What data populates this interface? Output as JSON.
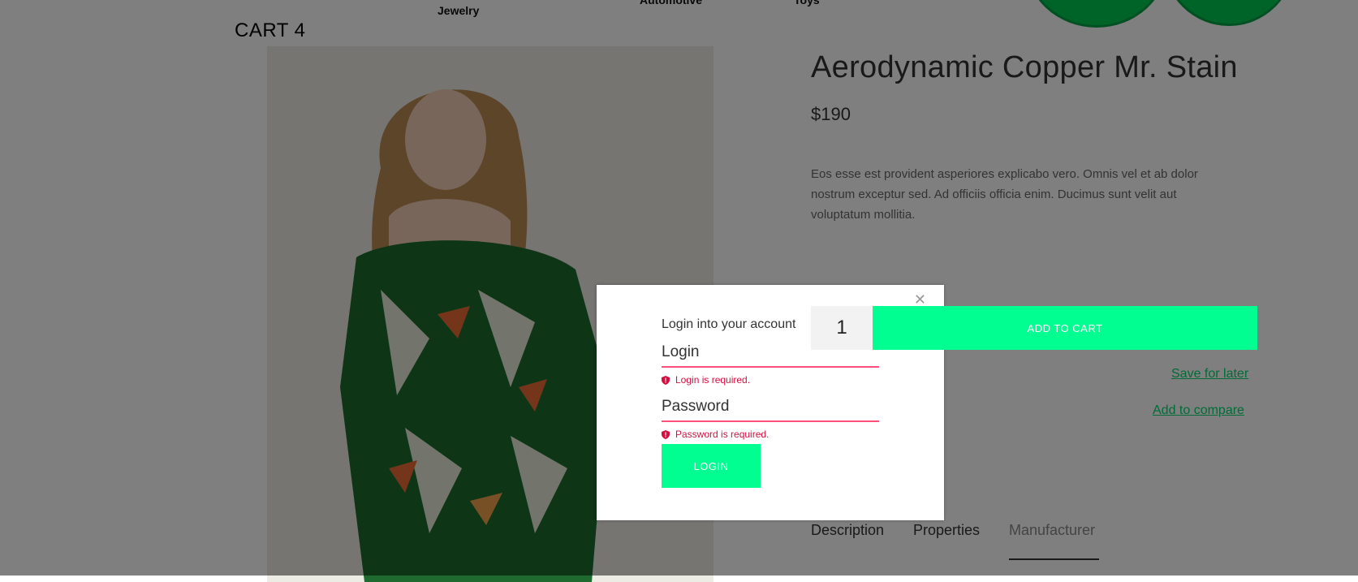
{
  "nav": {
    "items": [
      "Jewelry",
      "Automotive",
      "Toys"
    ]
  },
  "cart": {
    "label": "CART 4"
  },
  "product": {
    "title": "Aerodynamic Copper Mr. Stain",
    "price": "$190",
    "description": "Eos esse est provident asperiores explicabo vero. Omnis vel et ab dolor nostrum exceptur sed. Ad officiis officia enim. Ducimus sunt velit aut voluptatum mollitia.",
    "quantity": "1",
    "add_to_cart": "ADD TO CART",
    "save_for_later": "Save for later",
    "add_to_compare": "Add to compare",
    "tabs": [
      "Description",
      "Properties",
      "Manufacturer"
    ]
  },
  "modal": {
    "heading": "Login into your account",
    "login_label": "Login",
    "login_error": "Login is required.",
    "password_label": "Password",
    "password_error": "Password is required.",
    "submit": "LOGIN",
    "close_icon": "close-icon"
  },
  "colors": {
    "accent": "#00ff90",
    "link": "#00d86e",
    "error": "#d50f3f",
    "field_underline": "#ff4f7b",
    "overlay": "rgba(0,0,0,0.5)"
  }
}
